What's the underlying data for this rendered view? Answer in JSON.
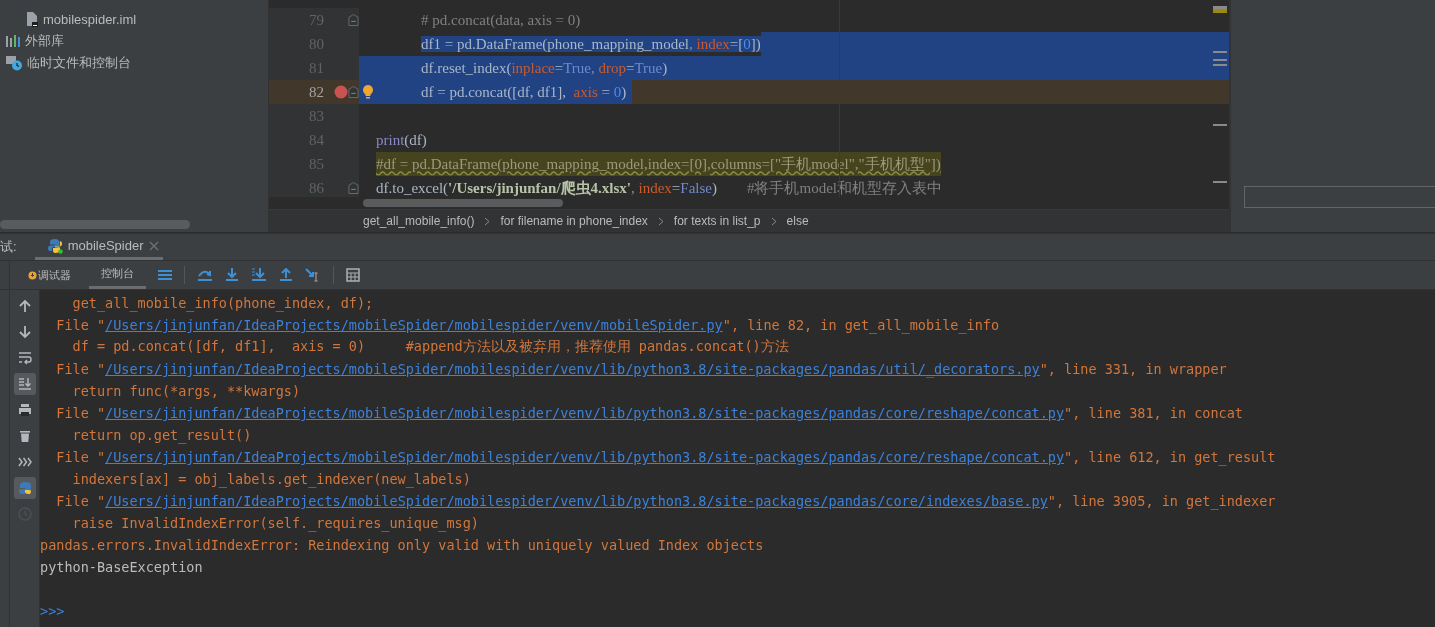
{
  "project_tree": [
    {
      "children": [
        {
          "label": "mobilespider.iml",
          "kind": "file"
        }
      ]
    },
    {
      "label": "外部库",
      "kind": "library"
    },
    {
      "label": "临时文件和控制台",
      "kind": "scratches"
    }
  ],
  "editor": {
    "lines": [
      {
        "number": "79",
        "fold_marker": true,
        "breakpoint": false,
        "intention_bulb": false,
        "kind": "unselected",
        "current": false,
        "tokens": [
          {
            "text": "            # pd.concat(data, axis = 0)",
            "kind": "comment"
          }
        ]
      },
      {
        "number": "80",
        "fold_marker": false,
        "breakpoint": false,
        "intention_bulb": false,
        "kind": "selected_from_text",
        "current": false,
        "tokens": [
          {
            "text": "            df1 = pd.DataFrame(phone_mapping_model",
            "kind": "plain"
          },
          {
            "text": ", ",
            "kind": "punct"
          },
          {
            "text": "index",
            "kind": "param"
          },
          {
            "text": "=[",
            "kind": "plain"
          },
          {
            "text": "0",
            "kind": "number"
          },
          {
            "text": "])",
            "kind": "plain"
          }
        ]
      },
      {
        "number": "81",
        "fold_marker": false,
        "breakpoint": false,
        "intention_bulb": false,
        "kind": "selected_full",
        "current": false,
        "tokens": [
          {
            "text": "            df.reset_index(",
            "kind": "plain"
          },
          {
            "text": "inplace",
            "kind": "param"
          },
          {
            "text": "=",
            "kind": "plain"
          },
          {
            "text": "True",
            "kind": "constant"
          },
          {
            "text": ", ",
            "kind": "punct"
          },
          {
            "text": "drop",
            "kind": "param"
          },
          {
            "text": "=",
            "kind": "plain"
          },
          {
            "text": "True",
            "kind": "constant"
          },
          {
            "text": ")",
            "kind": "plain"
          }
        ]
      },
      {
        "number": "82",
        "fold_marker": true,
        "breakpoint": true,
        "intention_bulb": true,
        "kind": "selected_to_text_end",
        "current": true,
        "tokens": [
          {
            "text": "            df = pd.concat([df, df1],  ",
            "kind": "plain"
          },
          {
            "text": "axis",
            "kind": "param"
          },
          {
            "text": " = ",
            "kind": "plain"
          },
          {
            "text": "0",
            "kind": "number"
          },
          {
            "text": ")",
            "kind": "plain"
          }
        ]
      },
      {
        "number": "83",
        "fold_marker": false,
        "breakpoint": false,
        "intention_bulb": false,
        "kind": "unselected",
        "current": false
      },
      {
        "number": "84",
        "fold_marker": false,
        "breakpoint": false,
        "intention_bulb": false,
        "kind": "unselected",
        "current": false,
        "tokens": [
          {
            "text": "print",
            "kind": "builtin"
          },
          {
            "text": "(df)",
            "kind": "plain"
          }
        ]
      },
      {
        "number": "85",
        "fold_marker": false,
        "breakpoint": false,
        "intention_bulb": false,
        "kind": "unselected",
        "current": false,
        "tokens": [
          {
            "text": "#df = pd.DataFrame(phone_mapping_model,index=[0],columns=[\"手机model\",\"手机机型\"])",
            "kind": "todo_comment"
          }
        ]
      },
      {
        "number": "86",
        "fold_marker": true,
        "breakpoint": false,
        "intention_bulb": false,
        "kind": "unselected",
        "current": false,
        "tokens": [
          {
            "text": "df.to_excel(",
            "kind": "plain"
          },
          {
            "text": "'/Users/jinjunfan/爬虫4.xlsx'",
            "kind": "string"
          },
          {
            "text": ", ",
            "kind": "punct"
          },
          {
            "text": "index",
            "kind": "param"
          },
          {
            "text": "=",
            "kind": "plain"
          },
          {
            "text": "False",
            "kind": "constant"
          },
          {
            "text": ")",
            "kind": "plain"
          },
          {
            "text": "        #将手机model和机型存入表中",
            "kind": "comment"
          }
        ]
      }
    ],
    "breadcrumbs": [
      "get_all_mobile_info()",
      "for filename in phone_index",
      "for texts in list_p",
      "else"
    ]
  },
  "debug": {
    "label": "试:",
    "run_tab": {
      "label": "mobileSpider",
      "selected": true
    },
    "tabs": [
      {
        "label": "调试器",
        "selected": false
      },
      {
        "label": "控制台",
        "selected": true
      }
    ],
    "side_tools": [
      {
        "kind": "up",
        "selected": false,
        "disabled": false
      },
      {
        "kind": "down",
        "selected": false,
        "disabled": false
      },
      {
        "kind": "wrap",
        "selected": false,
        "disabled": false
      },
      {
        "kind": "scroll_end",
        "selected": true,
        "disabled": false
      },
      {
        "kind": "print",
        "selected": false,
        "disabled": false
      },
      {
        "kind": "trash",
        "selected": false,
        "disabled": false
      },
      {
        "kind": "show",
        "selected": false,
        "disabled": false
      },
      {
        "kind": "python",
        "selected": true,
        "disabled": false
      },
      {
        "kind": "clock",
        "selected": false,
        "disabled": true
      }
    ]
  },
  "console": [
    {
      "kind": "error",
      "text": "    get_all_mobile_info(phone_index, df);"
    },
    {
      "kind": "file_ref",
      "before": "  File \"",
      "path": "/Users/jinjunfan/IdeaProjects/mobileSpider/mobilespider/venv/mobileSpider.py",
      "after": "\", line 82, in get_all_mobile_info"
    },
    {
      "kind": "error",
      "text": "    df = pd.concat([df, df1],  axis = 0)     #append方法以及被弃用，推荐使用 pandas.concat()方法"
    },
    {
      "kind": "file_ref",
      "before": "  File \"",
      "path": "/Users/jinjunfan/IdeaProjects/mobileSpider/mobilespider/venv/lib/python3.8/site-packages/pandas/util/_decorators.py",
      "after": "\", line 331, in wrapper"
    },
    {
      "kind": "error",
      "text": "    return func(*args, **kwargs)"
    },
    {
      "kind": "file_ref",
      "before": "  File \"",
      "path": "/Users/jinjunfan/IdeaProjects/mobileSpider/mobilespider/venv/lib/python3.8/site-packages/pandas/core/reshape/concat.py",
      "after": "\", line 381, in concat"
    },
    {
      "kind": "error",
      "text": "    return op.get_result()"
    },
    {
      "kind": "file_ref",
      "before": "  File \"",
      "path": "/Users/jinjunfan/IdeaProjects/mobileSpider/mobilespider/venv/lib/python3.8/site-packages/pandas/core/reshape/concat.py",
      "after": "\", line 612, in get_result"
    },
    {
      "kind": "error",
      "text": "    indexers[ax] = obj_labels.get_indexer(new_labels)"
    },
    {
      "kind": "file_ref",
      "before": "  File \"",
      "path": "/Users/jinjunfan/IdeaProjects/mobileSpider/mobilespider/venv/lib/python3.8/site-packages/pandas/core/indexes/base.py",
      "after": "\", line 3905, in get_indexer"
    },
    {
      "kind": "error",
      "text": "    raise InvalidIndexError(self._requires_unique_msg)"
    },
    {
      "kind": "error",
      "text": "pandas.errors.InvalidIndexError: Reindexing only valid with uniquely valued Index objects"
    },
    {
      "kind": "normal",
      "text": "python-BaseException"
    },
    {
      "kind": "blank"
    },
    {
      "kind": "prompt",
      "text": ">>>"
    }
  ]
}
